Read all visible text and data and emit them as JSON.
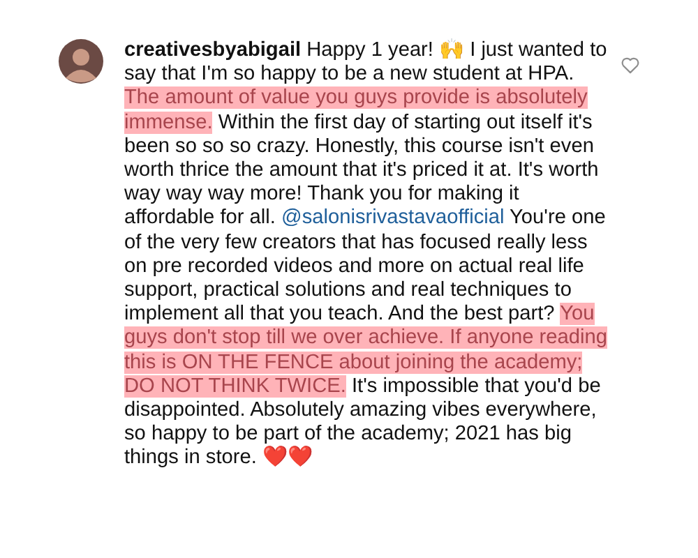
{
  "comment": {
    "liked": false,
    "segments": [
      {
        "kind": "username",
        "text": "creativesbyabigail"
      },
      {
        "kind": "text",
        "text": " Happy 1 year! 🙌 I just wanted to say that I'm so happy to be a new student at HPA. "
      },
      {
        "kind": "highlight",
        "text": "The amount of value you guys provide is absolutely immense."
      },
      {
        "kind": "text",
        "text": " Within the first day of starting out itself it's been so so so crazy. Honestly, this course isn't even worth thrice the amount that it's priced it at. It's worth way way way more! Thank you for making it affordable for all. "
      },
      {
        "kind": "mention",
        "text": "@salonisrivastavaofficial"
      },
      {
        "kind": "text",
        "text": " You're one of the very few creators that has focused really less on pre recorded videos and more on actual real life support, practical solutions and real techniques to implement all that you teach. And the best part? "
      },
      {
        "kind": "highlight",
        "text": "You guys don't stop till we over achieve. If anyone reading this is ON THE FENCE about joining the academy; DO NOT THINK TWICE."
      },
      {
        "kind": "text",
        "text": " It's impossible that you'd be disappointed. Absolutely amazing vibes everywhere, so happy to be part of the academy; 2021 has big things in store. ❤️❤️"
      }
    ]
  }
}
